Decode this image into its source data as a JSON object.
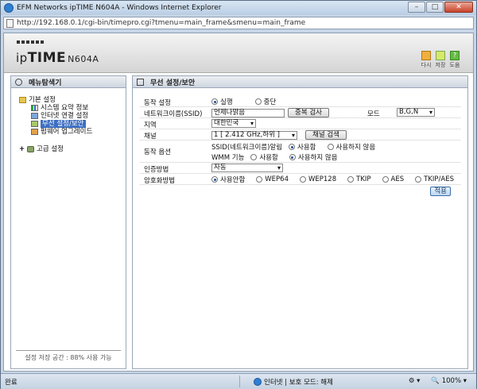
{
  "window": {
    "title": "EFM Networks ipTIME N604A - Windows Internet Explorer",
    "controls": {
      "minimize": "–",
      "maximize": "□",
      "close": "✕"
    }
  },
  "address": {
    "url": "http://192.168.0.1/cgi-bin/timepro.cgi?tmenu=main_frame&smenu=main_frame"
  },
  "header": {
    "logo_ip": "ip",
    "logo_time": "TIME",
    "logo_model": "N604A",
    "tools": [
      {
        "label": "다시",
        "icon": "refresh-icon"
      },
      {
        "label": "저장",
        "icon": "save-icon"
      },
      {
        "label": "도움",
        "icon": "help-icon",
        "glyph": "?"
      }
    ]
  },
  "sidebar": {
    "title": "메뉴탐색기",
    "basic_settings": "기본 설정",
    "items": [
      {
        "label": "시스템 요약 정보"
      },
      {
        "label": "인터넷 연결 설정"
      },
      {
        "label": "무선 설정/보안"
      },
      {
        "label": "펌웨어 업그레이드"
      }
    ],
    "selected_index": 2,
    "advanced_settings": "고급 설정",
    "expand_glyph": "+",
    "footer": "설정 저장 공간 : 88% 사용 가능"
  },
  "main": {
    "title": "무선 설정/보안",
    "operation": {
      "label": "동작 설정",
      "options": [
        "실행",
        "중단"
      ],
      "selected": "실행"
    },
    "ssid": {
      "label": "네트워크이름(SSID)",
      "value": "언제나맑음",
      "scan_button": "중복 검사",
      "mode_label": "모드",
      "mode_value": "B,G,N"
    },
    "region": {
      "label": "지역",
      "value": "대한민국"
    },
    "channel": {
      "label": "채널",
      "value": "1 [ 2.412 GHz,하위 ]",
      "search_button": "채널 검색"
    },
    "options": {
      "label": "동작 옵션",
      "ssid_broadcast": {
        "label": "SSID(네트워크이름)알림",
        "options": [
          "사용함",
          "사용하지 않음"
        ],
        "selected": "사용함"
      },
      "wmm": {
        "label": "WMM 기능",
        "options": [
          "사용함",
          "사용하지 않음"
        ],
        "selected": "사용하지 않음"
      }
    },
    "auth": {
      "label": "인증방법",
      "value": "자동"
    },
    "encryption": {
      "label": "암호화방법",
      "options": [
        "사용안함",
        "WEP64",
        "WEP128",
        "TKIP",
        "AES",
        "TKIP/AES"
      ],
      "selected": "사용안함"
    },
    "apply_button": "적용"
  },
  "status": {
    "left": "완료",
    "zone": "인터넷 | 보호 모드: 해제",
    "zoom": "100%"
  }
}
